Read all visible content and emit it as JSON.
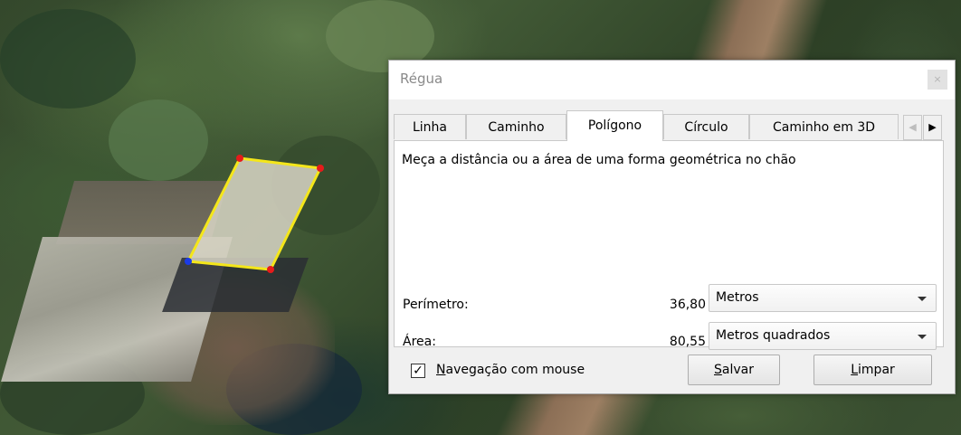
{
  "window": {
    "title": "Régua",
    "close_glyph": "×"
  },
  "tabs": [
    {
      "label": "Linha",
      "active": false
    },
    {
      "label": "Caminho",
      "active": false
    },
    {
      "label": "Polígono",
      "active": true
    },
    {
      "label": "Círculo",
      "active": false
    },
    {
      "label": "Caminho em 3D",
      "active": false
    }
  ],
  "tab_scroll": {
    "left_icon": "chevron-left-icon",
    "right_icon": "chevron-right-icon"
  },
  "panel": {
    "description": "Meça a distância ou a área de uma forma geométrica no chão",
    "perimeter": {
      "label": "Perímetro:",
      "value": "36,80",
      "unit": "Metros"
    },
    "area": {
      "label": "Área:",
      "value": "80,55",
      "unit": "Metros quadrados"
    }
  },
  "footer": {
    "mouse_nav": {
      "checked": true,
      "label_first": "N",
      "label_rest": "avegação com mouse"
    },
    "save": {
      "first": "S",
      "rest": "alvar"
    },
    "clear": {
      "first": "L",
      "rest": "impar"
    }
  },
  "colors": {
    "polygon_line": "#f4e61a",
    "vertex_red": "#e61b1b",
    "vertex_blue": "#1b3be6"
  }
}
